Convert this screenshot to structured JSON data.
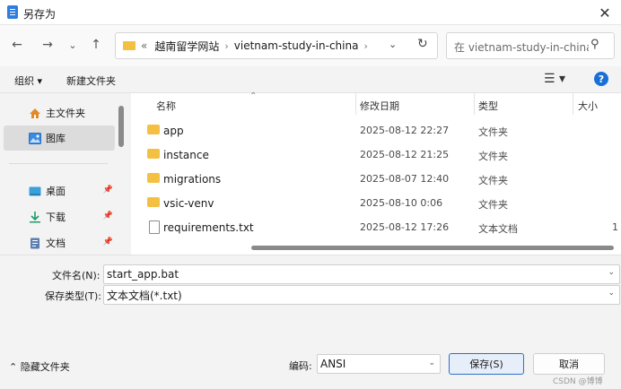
{
  "window": {
    "title": "另存为",
    "close": "✕"
  },
  "nav": {
    "back": "←",
    "forward": "→",
    "recent": "⌄",
    "up": "↑",
    "address": {
      "prefix": "«",
      "parts": [
        "越南留学网站",
        "vietnam-study-in-china"
      ],
      "sep": "›",
      "trail_sep": "›",
      "chev": "⌄",
      "refresh": "↻"
    },
    "search": {
      "placeholder": "在 vietnam-study-in-china 中搜索",
      "icon": "⚲"
    }
  },
  "toolbar": {
    "organize": "组织 ▾",
    "new_folder": "新建文件夹",
    "view": "☰ ▾",
    "help": "?"
  },
  "sidebar": {
    "items": [
      {
        "label": "主文件夹",
        "icon": "home-icon"
      },
      {
        "label": "图库",
        "icon": "gallery-icon"
      },
      {
        "label": "桌面",
        "icon": "desktop-icon",
        "pinned": true
      },
      {
        "label": "下载",
        "icon": "download-icon",
        "pinned": true
      },
      {
        "label": "文档",
        "icon": "document-icon",
        "pinned": true
      }
    ],
    "pin": "📌"
  },
  "file_list": {
    "columns": {
      "name": "名称",
      "date": "修改日期",
      "type": "类型",
      "size": "大小",
      "sort": "⌃"
    },
    "rows": [
      {
        "name": "app",
        "date": "2025-08-12 22:27",
        "type": "文件夹",
        "size": ""
      },
      {
        "name": "instance",
        "date": "2025-08-12 21:25",
        "type": "文件夹",
        "size": ""
      },
      {
        "name": "migrations",
        "date": "2025-08-07 12:40",
        "type": "文件夹",
        "size": ""
      },
      {
        "name": "vsic-venv",
        "date": "2025-08-10 0:06",
        "type": "文件夹",
        "size": ""
      },
      {
        "name": "requirements.txt",
        "date": "2025-08-12 17:26",
        "type": "文本文档",
        "size": "1"
      }
    ]
  },
  "form": {
    "filename_label": "文件名(N):",
    "filename_value": "start_app.bat",
    "filetype_label": "保存类型(T):",
    "filetype_value": "文本文档(*.txt)",
    "chev": "⌄"
  },
  "bottom": {
    "hide_folders": "⌃  隐藏文件夹",
    "encoding_label": "编码:",
    "encoding_value": "ANSI",
    "save": "保存(S)",
    "cancel": "取消",
    "watermark": "CSDN @博博"
  }
}
